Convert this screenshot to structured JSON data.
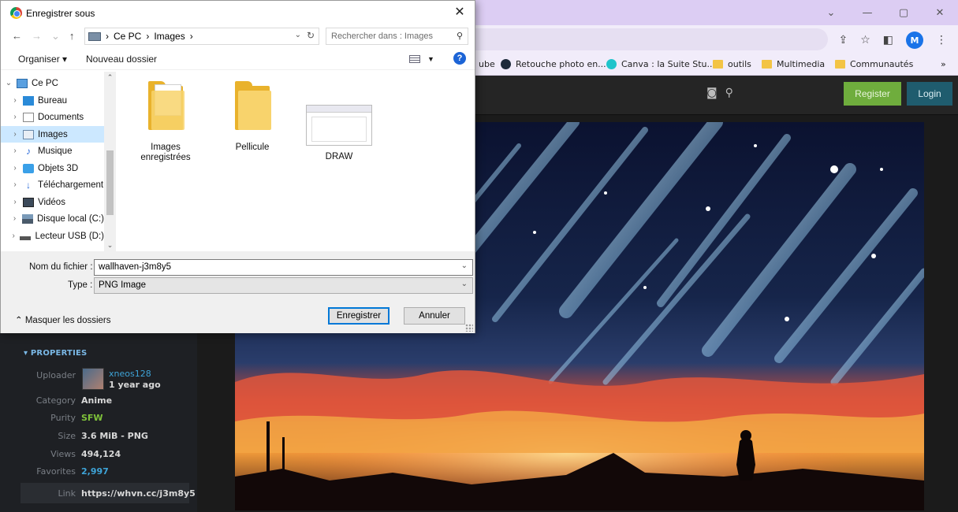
{
  "browser": {
    "bookmarks": [
      {
        "label": "ube",
        "icon": "none"
      },
      {
        "label": "Retouche photo en...",
        "icon": "photo-editor-icon"
      },
      {
        "label": "Canva : la Suite Stu...",
        "icon": "canva-icon"
      },
      {
        "label": "outils",
        "icon": "folder-icon"
      },
      {
        "label": "Multimedia",
        "icon": "folder-icon"
      },
      {
        "label": "Communautés",
        "icon": "folder-icon"
      }
    ],
    "more_bookmarks": "»",
    "avatar_letter": "M",
    "colors": {
      "titlebar": "#dccdf3",
      "toolbar": "#f1ecfa"
    }
  },
  "site": {
    "register_label": "Register",
    "login_label": "Login",
    "properties": {
      "title": "▾ PROPERTIES",
      "uploader_label": "Uploader",
      "uploader_name": "xneos128",
      "uploaded_ago": "1 year ago",
      "category_label": "Category",
      "category": "Anime",
      "purity_label": "Purity",
      "purity": "SFW",
      "size_label": "Size",
      "size": "3.6 MiB - PNG",
      "views_label": "Views",
      "views": "494,124",
      "favorites_label": "Favorites",
      "favorites": "2,997",
      "link_label": "Link",
      "link": "https://whvn.cc/j3m8y5"
    },
    "colors": {
      "register": "#6fad3d",
      "login": "#1f5c6e",
      "accent_blue": "#3ea4d8",
      "accent_green": "#7fc23a"
    }
  },
  "dialog": {
    "title": "Enregistrer sous",
    "path": [
      "Ce PC",
      "Images"
    ],
    "search_placeholder": "Rechercher dans : Images",
    "organize_label": "Organiser ▾",
    "new_folder_label": "Nouveau dossier",
    "tree": [
      {
        "label": "Ce PC",
        "expanded": true,
        "selected": false
      },
      {
        "label": "Bureau",
        "selected": false
      },
      {
        "label": "Documents",
        "selected": false
      },
      {
        "label": "Images",
        "selected": true
      },
      {
        "label": "Musique",
        "selected": false
      },
      {
        "label": "Objets 3D",
        "selected": false
      },
      {
        "label": "Téléchargement",
        "selected": false
      },
      {
        "label": "Vidéos",
        "selected": false
      },
      {
        "label": "Disque local (C:)",
        "selected": false
      },
      {
        "label": "Lecteur USB (D:)",
        "selected": false
      }
    ],
    "files": [
      {
        "name": "Images enregistrées"
      },
      {
        "name": "Pellicule"
      },
      {
        "name": "DRAW"
      }
    ],
    "filename_label": "Nom du fichier :",
    "filename_value": "wallhaven-j3m8y5",
    "type_label": "Type :",
    "type_value": "PNG Image",
    "hide_folders_label": "Masquer les dossiers",
    "save_label": "Enregistrer",
    "cancel_label": "Annuler"
  }
}
